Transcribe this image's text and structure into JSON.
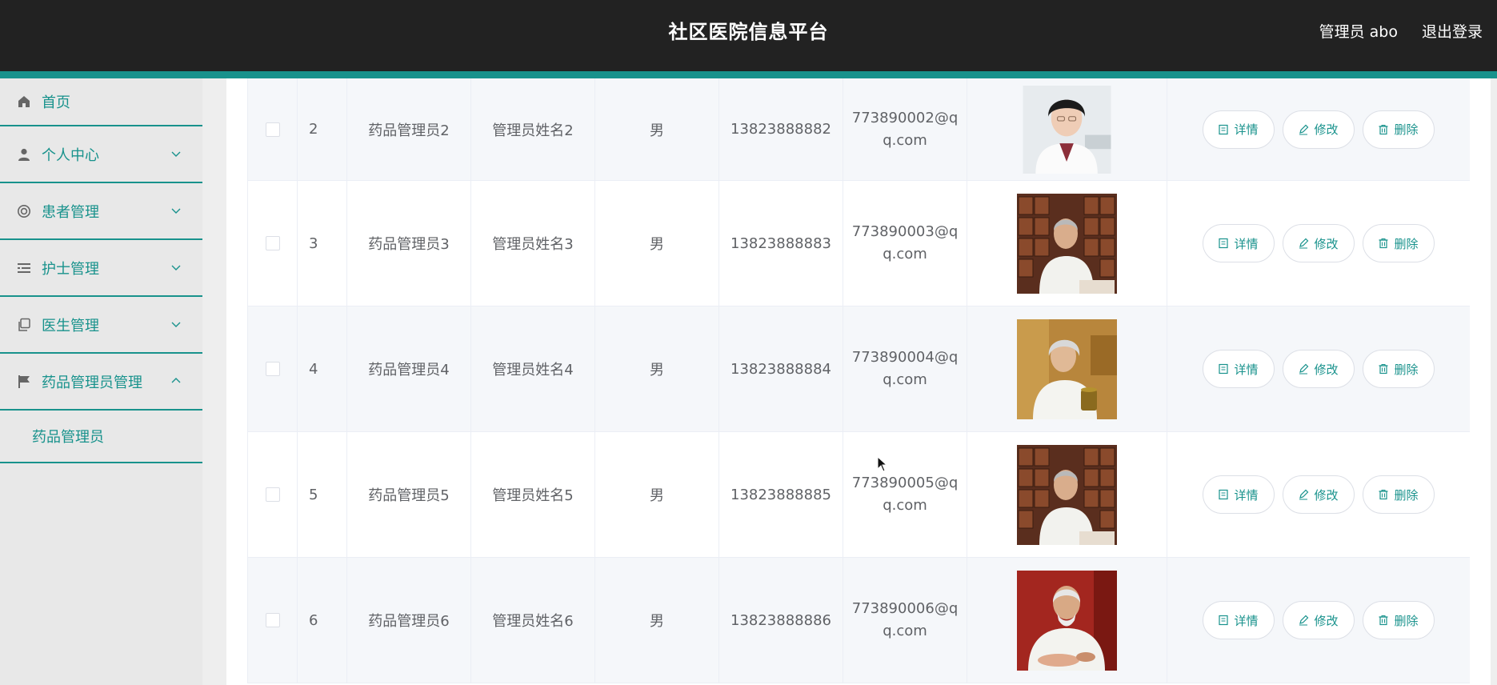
{
  "header": {
    "title": "社区医院信息平台",
    "user_label": "管理员 abo",
    "logout_label": "退出登录"
  },
  "sidebar": {
    "items": [
      {
        "label": "首页",
        "icon": "home-icon"
      },
      {
        "label": "个人中心",
        "icon": "user-icon"
      },
      {
        "label": "患者管理",
        "icon": "patient-icon"
      },
      {
        "label": "护士管理",
        "icon": "list-icon"
      },
      {
        "label": "医生管理",
        "icon": "copy-icon"
      },
      {
        "label": "药品管理员管理",
        "icon": "flag-icon"
      }
    ],
    "sub_items": [
      {
        "label": "药品管理员"
      }
    ]
  },
  "table": {
    "rows": [
      {
        "index": "2",
        "account": "药品管理员2",
        "name": "管理员姓名2",
        "sex": "男",
        "phone": "13823888882",
        "email": "773890002@qq.com"
      },
      {
        "index": "3",
        "account": "药品管理员3",
        "name": "管理员姓名3",
        "sex": "男",
        "phone": "13823888883",
        "email": "773890003@qq.com"
      },
      {
        "index": "4",
        "account": "药品管理员4",
        "name": "管理员姓名4",
        "sex": "男",
        "phone": "13823888884",
        "email": "773890004@qq.com"
      },
      {
        "index": "5",
        "account": "药品管理员5",
        "name": "管理员姓名5",
        "sex": "男",
        "phone": "13823888885",
        "email": "773890005@qq.com"
      },
      {
        "index": "6",
        "account": "药品管理员6",
        "name": "管理员姓名6",
        "sex": "男",
        "phone": "13823888886",
        "email": "773890006@qq.com"
      }
    ],
    "actions": {
      "detail": "详情",
      "edit": "修改",
      "delete": "删除"
    }
  },
  "colors": {
    "accent": "#18928c",
    "header_bg": "#222222",
    "sidebar_bg": "#e8e8e8"
  }
}
